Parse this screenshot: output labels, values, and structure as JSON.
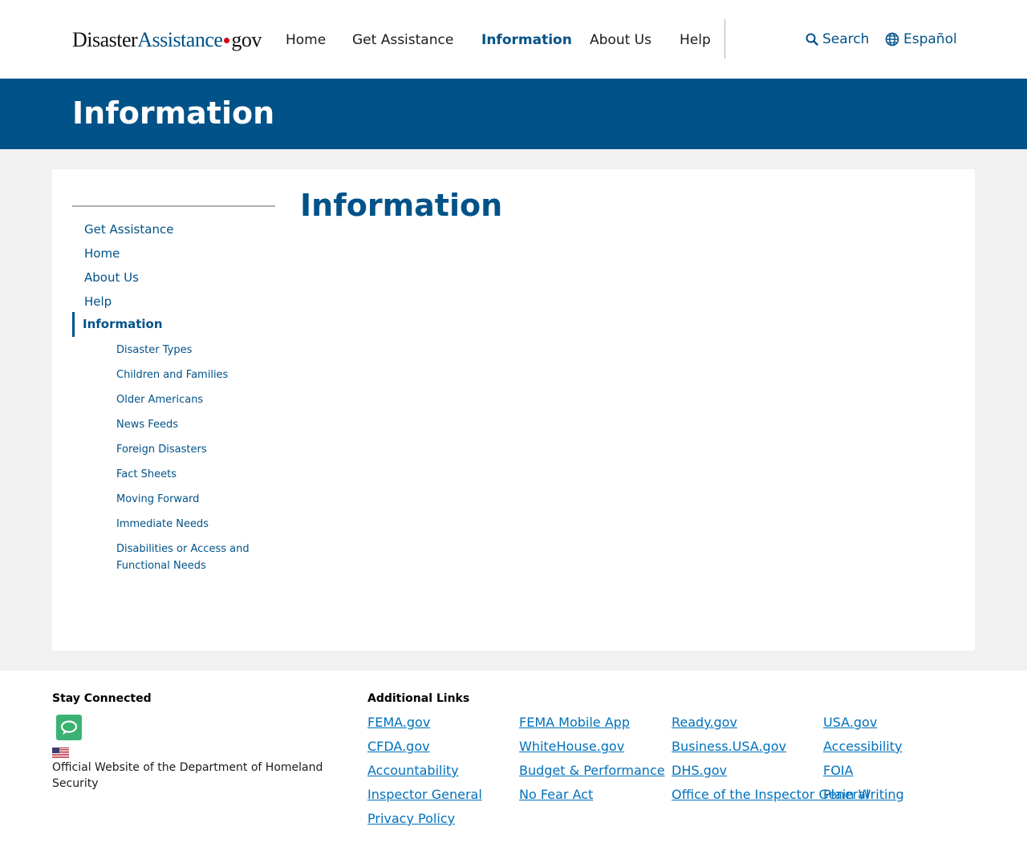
{
  "header": {
    "logo": {
      "part1": "Disaster",
      "part2": "Assistance",
      "part3": "gov"
    },
    "nav": [
      {
        "label": "Home",
        "active": false
      },
      {
        "label": "Get Assistance",
        "active": false
      },
      {
        "label": "Information",
        "active": true
      },
      {
        "label": "About Us",
        "active": false
      },
      {
        "label": "Help",
        "active": false
      }
    ],
    "search_label": "Search",
    "language_label": "Español"
  },
  "banner": {
    "title": "Information"
  },
  "sidebar": {
    "links": [
      {
        "label": "Get Assistance"
      },
      {
        "label": "Home"
      },
      {
        "label": "About Us"
      },
      {
        "label": "Help"
      }
    ],
    "active": {
      "label": "Information"
    },
    "sublinks": [
      {
        "label": "Disaster Types"
      },
      {
        "label": "Children and Families"
      },
      {
        "label": "Older Americans"
      },
      {
        "label": "News Feeds"
      },
      {
        "label": "Foreign Disasters"
      },
      {
        "label": "Fact Sheets"
      },
      {
        "label": "Moving Forward"
      },
      {
        "label": "Immediate Needs"
      },
      {
        "label": "Disabilities or Access and Functional Needs"
      }
    ]
  },
  "main": {
    "title": "Information"
  },
  "footer": {
    "stay_connected": "Stay Connected",
    "official_text": "Official Website of the Department of Homeland Security",
    "additional_links_heading": "Additional Links",
    "links": [
      {
        "label": "FEMA.gov"
      },
      {
        "label": "FEMA Mobile App"
      },
      {
        "label": "Ready.gov"
      },
      {
        "label": "USA.gov"
      },
      {
        "label": "CFDA.gov"
      },
      {
        "label": "WhiteHouse.gov"
      },
      {
        "label": "Business.USA.gov"
      },
      {
        "label": "Accessibility"
      },
      {
        "label": "Accountability"
      },
      {
        "label": "Budget & Performance"
      },
      {
        "label": "DHS.gov"
      },
      {
        "label": "FOIA"
      },
      {
        "label": "Inspector General"
      },
      {
        "label": "No Fear Act"
      },
      {
        "label": "Office of the Inspector General"
      },
      {
        "label": "Plain Writing"
      },
      {
        "label": "Privacy Policy"
      }
    ]
  },
  "colors": {
    "brand_blue": "#005288",
    "link_blue": "#0071bc",
    "logo_dot_red": "#d0021b",
    "chat_green": "#3bb273",
    "page_gray": "#f1f1f1"
  },
  "icons": {
    "search": "search-icon",
    "language": "globe-icon",
    "chat": "chat-icon",
    "flag": "us-flag-icon"
  }
}
